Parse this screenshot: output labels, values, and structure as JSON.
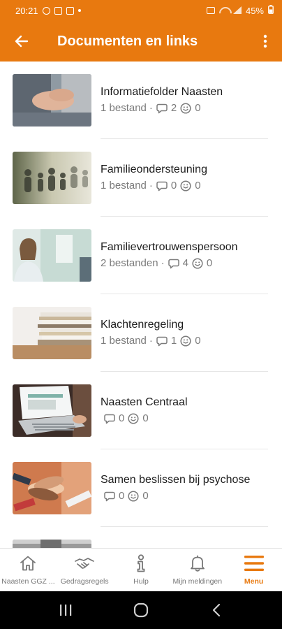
{
  "status_bar": {
    "time": "20:21",
    "battery": "45%"
  },
  "app_bar": {
    "title": "Documenten en links"
  },
  "colors": {
    "accent": "#e8790f",
    "meta_text": "#7b7b7b"
  },
  "items": [
    {
      "title": "Informatiefolder Naasten",
      "files": "1 bestand",
      "comments": "2",
      "reactions": "0",
      "thumbnail": "hands-photo"
    },
    {
      "title": "Familieondersteuning",
      "files": "1 bestand",
      "comments": "0",
      "reactions": "0",
      "thumbnail": "paper-family-photo"
    },
    {
      "title": "Familievertrouwenspersoon",
      "files": "2 bestanden",
      "comments": "4",
      "reactions": "0",
      "thumbnail": "woman-smiling-photo"
    },
    {
      "title": "Klachtenregeling",
      "files": "1 bestand",
      "comments": "1",
      "reactions": "0",
      "thumbnail": "paper-stack-photo"
    },
    {
      "title": "Naasten Centraal",
      "files": "",
      "comments": "0",
      "reactions": "0",
      "thumbnail": "laptop-photo"
    },
    {
      "title": "Samen beslissen bij psychose",
      "files": "",
      "comments": "0",
      "reactions": "0",
      "thumbnail": "stacked-hands-photo"
    }
  ],
  "bottom_nav": [
    {
      "label": "Naasten GGZ ...",
      "icon": "home-icon",
      "active": false
    },
    {
      "label": "Gedragsregels",
      "icon": "handshake-icon",
      "active": false
    },
    {
      "label": "Hulp",
      "icon": "info-icon",
      "active": false
    },
    {
      "label": "Mijn meldingen",
      "icon": "bell-icon",
      "active": false
    },
    {
      "label": "Menu",
      "icon": "menu-icon",
      "active": true
    }
  ]
}
